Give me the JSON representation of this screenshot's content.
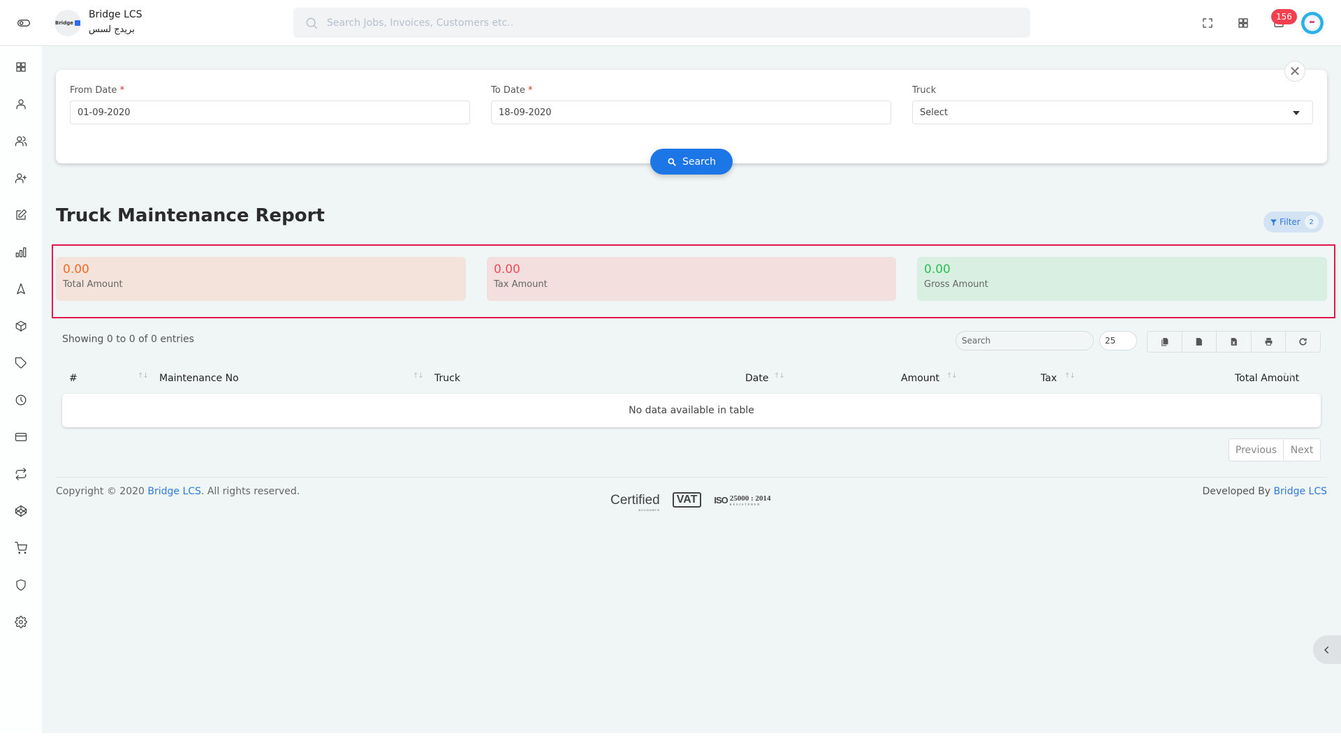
{
  "header": {
    "brand_name": "Bridge LCS",
    "brand_name_ar": "بريدج لسس",
    "logo_text": "Bridge",
    "search_placeholder": "Search Jobs, Invoices, Customers etc..",
    "notification_count": "156"
  },
  "sidebar": {
    "items": [
      {
        "icon": "dashboard-icon"
      },
      {
        "icon": "user-icon"
      },
      {
        "icon": "users-icon"
      },
      {
        "icon": "user-plus-icon"
      },
      {
        "icon": "edit-icon"
      },
      {
        "icon": "bar-chart-icon"
      },
      {
        "icon": "navigation-icon"
      },
      {
        "icon": "package-icon"
      },
      {
        "icon": "tag-icon"
      },
      {
        "icon": "clock-icon"
      },
      {
        "icon": "credit-card-icon"
      },
      {
        "icon": "repeat-icon"
      },
      {
        "icon": "codepen-icon"
      },
      {
        "icon": "shopping-cart-icon"
      },
      {
        "icon": "shield-icon"
      },
      {
        "icon": "settings-icon"
      }
    ]
  },
  "filters": {
    "from_date_label": "From Date",
    "from_date_value": "01-09-2020",
    "to_date_label": "To Date",
    "to_date_value": "18-09-2020",
    "required_mark": "*",
    "truck_label": "Truck",
    "truck_value": "Select",
    "close_label": "✕",
    "search_button": "Search"
  },
  "report": {
    "title": "Truck Maintenance Report",
    "filter_chip_label": "Filter",
    "filter_chip_count": "2",
    "stats": [
      {
        "value": "0.00",
        "label": "Total Amount",
        "color": "#f26b2a",
        "bg": "#f3e3db"
      },
      {
        "value": "0.00",
        "label": "Tax Amount",
        "color": "#ef4d57",
        "bg": "#f4dfdf"
      },
      {
        "value": "0.00",
        "label": "Gross Amount",
        "color": "#2cbf55",
        "bg": "#d8efe2"
      }
    ]
  },
  "table": {
    "showing_text": "Showing 0 to 0 of 0 entries",
    "search_placeholder": "Search",
    "page_length": "25",
    "tools": [
      "copy-icon",
      "csv-icon",
      "excel-icon",
      "print-icon",
      "refresh-icon"
    ],
    "columns": [
      "#",
      "Maintenance No",
      "Truck",
      "Date",
      "Amount",
      "Tax",
      "Total Amount"
    ],
    "empty_message": "No data available in table",
    "pager": {
      "previous": "Previous",
      "next": "Next"
    }
  },
  "footer": {
    "copyright_prefix": "Copyright © 2020 ",
    "copyright_link": "Bridge LCS",
    "copyright_suffix": ". All rights reserved.",
    "developed_prefix": "Developed By ",
    "developed_link": "Bridge LCS",
    "cert_certified": "Certified",
    "cert_certified_sub": "ACCOUNTS",
    "cert_vat": "VAT",
    "cert_iso": "ISO",
    "cert_iso_number": "25000 : 2014",
    "cert_iso_sub": "REGISTERED"
  }
}
